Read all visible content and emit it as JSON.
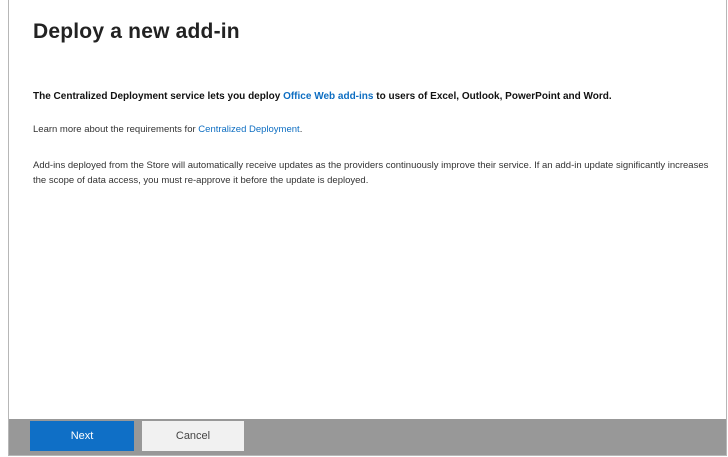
{
  "dialog": {
    "title": "Deploy a new add-in",
    "intro": {
      "prefix": "The Centralized Deployment service lets you deploy ",
      "link": "Office Web add-ins",
      "suffix": " to users of Excel, Outlook, PowerPoint and Word."
    },
    "learn_more": {
      "prefix": "Learn more about the requirements for ",
      "link": "Centralized Deployment",
      "suffix": "."
    },
    "description": "Add-ins deployed from the Store will automatically receive updates as the providers continuously improve their service. If an add-in update significantly increases the scope of data access, you must re-approve it before the update is deployed."
  },
  "footer": {
    "next_label": "Next",
    "cancel_label": "Cancel"
  },
  "colors": {
    "accent": "#0f6fc6",
    "link": "#0e6ec2",
    "footer_bg": "#989898"
  }
}
